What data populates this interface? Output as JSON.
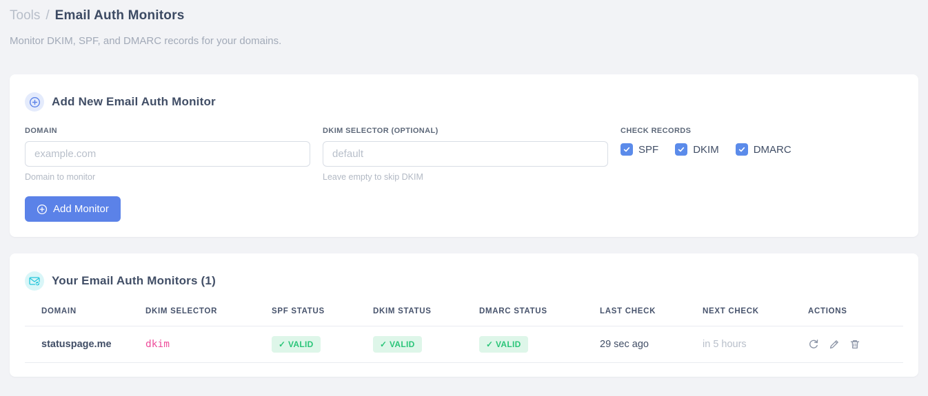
{
  "page": {
    "breadcrumb": {
      "section": "Tools",
      "separator": "/",
      "title": "Email Auth Monitors"
    },
    "subtitle": "Monitor DKIM, SPF, and DMARC records for your domains."
  },
  "add_card": {
    "icon": "plus-circle-icon",
    "title": "Add New Email Auth Monitor",
    "fields": {
      "domain": {
        "label": "DOMAIN",
        "value": "",
        "placeholder": "example.com",
        "helper": "Domain to monitor"
      },
      "dkim_selector": {
        "label": "DKIM SELECTOR (OPTIONAL)",
        "value": "",
        "placeholder": "default",
        "helper": "Leave empty to skip DKIM"
      }
    },
    "check_records": {
      "label": "CHECK RECORDS",
      "options": [
        {
          "label": "SPF",
          "checked": true
        },
        {
          "label": "DKIM",
          "checked": true
        },
        {
          "label": "DMARC",
          "checked": true
        }
      ]
    },
    "submit": {
      "icon": "plus-circle-icon",
      "label": "Add Monitor"
    }
  },
  "monitors_card": {
    "icon": "mail-check-icon",
    "title": "Your Email Auth Monitors (1)",
    "table": {
      "headers": [
        "DOMAIN",
        "DKIM SELECTOR",
        "SPF STATUS",
        "DKIM STATUS",
        "DMARC STATUS",
        "LAST CHECK",
        "NEXT CHECK",
        "ACTIONS"
      ],
      "rows": [
        {
          "domain": "statuspage.me",
          "dkim_selector": "dkim",
          "spf_status": "✓ VALID",
          "dkim_status": "✓ VALID",
          "dmarc_status": "✓ VALID",
          "last_check": "29 sec ago",
          "next_check": "in 5 hours",
          "actions": [
            "refresh-icon",
            "edit-icon",
            "delete-icon"
          ]
        }
      ]
    }
  },
  "colors": {
    "accent_blue": "#5b82e8",
    "checkbox_blue": "#5b8bea",
    "badge_green_bg": "#def6e9",
    "badge_green_text": "#2bc579",
    "selector_pink": "#ee4d9b",
    "icon_cyan": "#26c6da",
    "page_bg": "#f2f3f6"
  }
}
